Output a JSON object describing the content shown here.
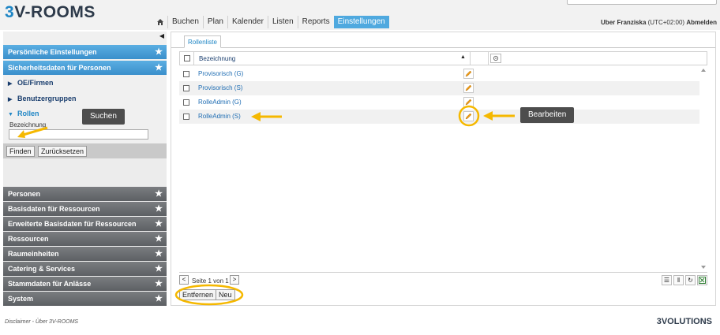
{
  "app": {
    "logo_prefix": "3",
    "logo_text": "V-ROOMS"
  },
  "nav": {
    "items": [
      "Buchen",
      "Plan",
      "Kalender",
      "Listen",
      "Reports",
      "Einstellungen"
    ],
    "active_index": 5
  },
  "user": {
    "name": "Uber Franziska",
    "timezone": "(UTC+02:00)",
    "logout": "Abmelden"
  },
  "sidebar": {
    "top_sections": [
      "Persönliche Einstellungen",
      "Sicherheitsdaten für Personen"
    ],
    "subitems": [
      "OE/Firmen",
      "Benutzergruppen",
      "Rollen"
    ],
    "field_label": "Bezeichnung",
    "field_value": "",
    "find_button": "Finden",
    "reset_button": "Zurücksetzen",
    "bottom_sections": [
      "Personen",
      "Basisdaten für Ressourcen",
      "Erweiterte Basisdaten für Ressourcen",
      "Ressourcen",
      "Raumeinheiten",
      "Catering & Services",
      "Stammdaten für Anlässe",
      "System"
    ]
  },
  "main": {
    "tab_label": "Rollenliste",
    "column_header": "Bezeichnung",
    "rows": [
      "Provisorisch (G)",
      "Provisorisch (S)",
      "RolleAdmin (G)",
      "RolleAdmin (S)"
    ],
    "pager_text": "Seite 1 von 1",
    "remove_button": "Entfernen",
    "new_button": "Neu"
  },
  "callouts": {
    "search": "Suchen",
    "edit": "Bearbeiten"
  },
  "footer": {
    "left": "Disclaimer - Über 3V-ROOMS",
    "right": "3VOLUTIONS"
  },
  "colors": {
    "accent_blue": "#4fa9df",
    "annotation": "#f5b800",
    "section_gray": "#5d6064"
  }
}
